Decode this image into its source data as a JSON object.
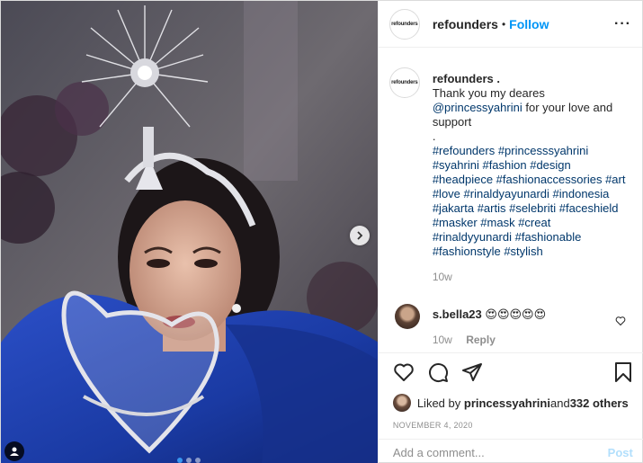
{
  "header": {
    "avatar_text": "refounders",
    "username": "refounders",
    "separator": "•",
    "follow_label": "Follow",
    "more_label": "···"
  },
  "caption": {
    "avatar_text": "refounders",
    "username": "refounders .",
    "line1": "Thank you my deares",
    "mention": "@princessyahrini",
    "line2": " for your love and support",
    "dot": ".",
    "hashtags": "#refounders #princesssyahrini #syahrini #fashion #design #headpiece #fashionaccessories #art #love #rinaldyayunardi #indonesia #jakarta #artis #selebriti #faceshield #masker #mask #creat #rinaldyyunardi #fashionable #fashionstyle #stylish",
    "age": "10w"
  },
  "comment": {
    "username": "s.bella23",
    "text": "😍😍😍😍😍",
    "age": "10w",
    "reply_label": "Reply"
  },
  "likes": {
    "prefix": "Liked by ",
    "user": "princessyahrini",
    "middle": " and ",
    "others": "332 others"
  },
  "date": "NOVEMBER 4, 2020",
  "add_comment": {
    "placeholder": "Add a comment...",
    "post_label": "Post"
  },
  "icons": {
    "like": "heart-icon",
    "comment": "comment-icon",
    "share": "share-icon",
    "save": "bookmark-icon",
    "next": "chevron-right-icon",
    "tag": "user-tag-icon"
  },
  "colors": {
    "link": "#0095f6",
    "hashtag": "#00376b",
    "muted": "#8e8e8e",
    "post_disabled": "#b2dffc",
    "dress": "#1e3fa8"
  },
  "carousel": {
    "count": 3,
    "active_index": 0
  }
}
